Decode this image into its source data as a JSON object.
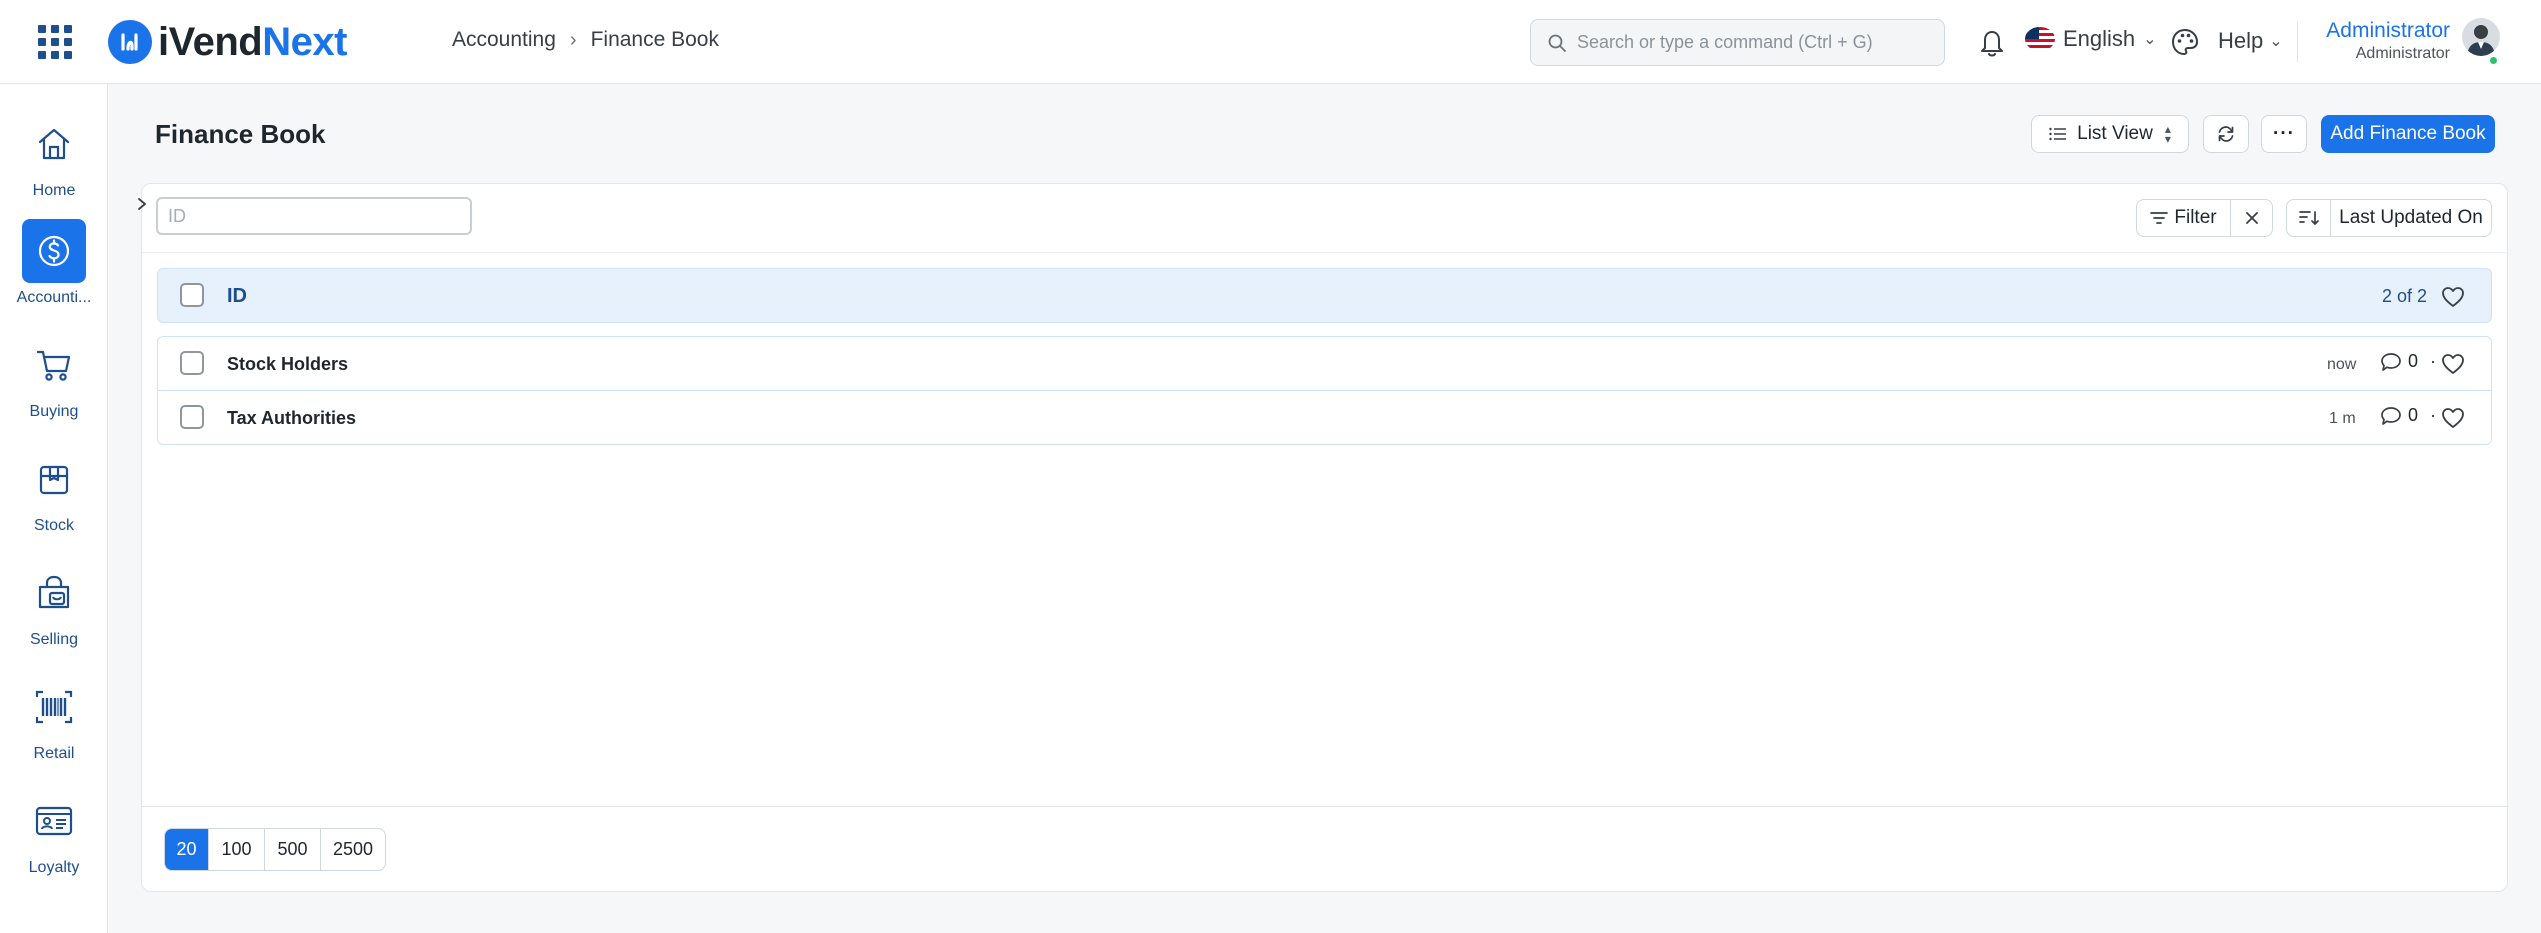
{
  "app": {
    "logo_a": "iVend",
    "logo_b": "Next"
  },
  "breadcrumb": {
    "section": "Accounting",
    "page": "Finance Book"
  },
  "search": {
    "placeholder": "Search or type a command (Ctrl + G)"
  },
  "language": {
    "label": "English"
  },
  "help": {
    "label": "Help"
  },
  "user": {
    "name": "Administrator",
    "role": "Administrator"
  },
  "sidebar": {
    "items": [
      {
        "label": "Home",
        "icon": "home-icon",
        "active": false
      },
      {
        "label": "Accounti...",
        "icon": "dollar-circle-icon",
        "active": true
      },
      {
        "label": "Buying",
        "icon": "cart-icon",
        "active": false
      },
      {
        "label": "Stock",
        "icon": "box-icon",
        "active": false
      },
      {
        "label": "Selling",
        "icon": "shopping-bag-icon",
        "active": false
      },
      {
        "label": "Retail",
        "icon": "barcode-icon",
        "active": false
      },
      {
        "label": "Loyalty",
        "icon": "id-card-icon",
        "active": false
      }
    ]
  },
  "page": {
    "title": "Finance Book",
    "list_view_label": "List View",
    "more_label": "···",
    "add_label": "Add Finance Book"
  },
  "filters": {
    "id_placeholder": "ID",
    "filter_label": "Filter",
    "sort_label": "Last Updated On"
  },
  "list": {
    "header_label": "ID",
    "count": "2 of 2",
    "rows": [
      {
        "title": "Stock Holders",
        "modified": "now",
        "comments": "0"
      },
      {
        "title": "Tax Authorities",
        "modified": "1 m",
        "comments": "0"
      }
    ],
    "separator": "·"
  },
  "paging": {
    "sizes": [
      "20",
      "100",
      "500",
      "2500"
    ],
    "active": "20"
  },
  "colors": {
    "accent": "#1a73e8",
    "nav": "#1f4e8c",
    "head_bg": "#e6f1fb",
    "online": "#2ec16c"
  }
}
